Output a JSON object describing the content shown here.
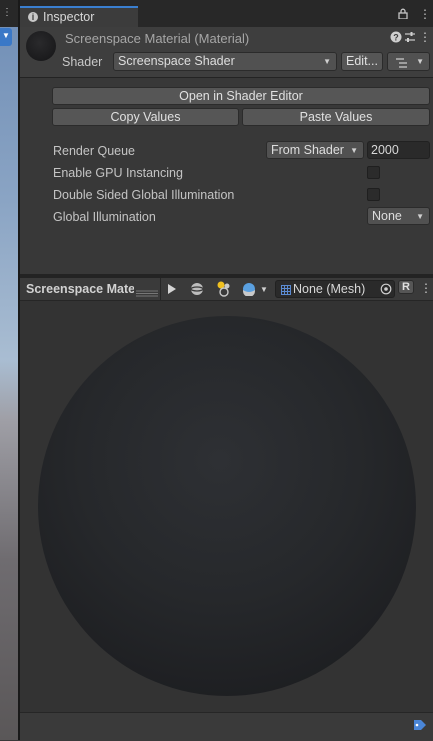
{
  "window": {
    "tab_label": "Inspector"
  },
  "header": {
    "material_title": "Screenspace Material (Material)",
    "shader_label": "Shader",
    "shader_value": "Screenspace Shader",
    "edit_button": "Edit..."
  },
  "buttons": {
    "open_in_shader_editor": "Open in Shader Editor",
    "copy_values": "Copy Values",
    "paste_values": "Paste Values"
  },
  "properties": {
    "render_queue_label": "Render Queue",
    "render_queue_mode": "From Shader",
    "render_queue_value": "2000",
    "gpu_instancing_label": "Enable GPU Instancing",
    "gpu_instancing_checked": false,
    "double_sided_gi_label": "Double Sided Global Illumination",
    "double_sided_gi_checked": false,
    "global_illumination_label": "Global Illumination",
    "global_illumination_value": "None"
  },
  "preview": {
    "title": "Screenspace Material",
    "mesh_field": "None (Mesh)",
    "reset_label": "R"
  },
  "colors": {
    "accent": "#3a7fd0",
    "panel_bg": "#383838"
  }
}
